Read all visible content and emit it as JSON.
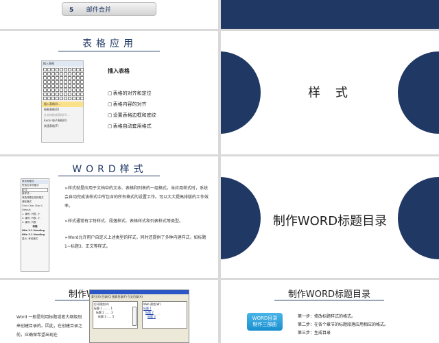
{
  "slide1": {
    "num": "5",
    "label": "邮件合并"
  },
  "slide3": {
    "title": "表格应用",
    "menu": {
      "header": "插入表格",
      "items": [
        "插入表格(I)...",
        "绘制表格(D)",
        "文本转换成表格(V)...",
        "Excel 电子表格(X)",
        "快速表格(T)"
      ]
    },
    "heading": "插入表格",
    "bullets": [
      "表格的对齐和定位",
      "表格内容的对齐",
      "设置表格边框和底纹",
      "表格自动套用格式"
    ]
  },
  "slide4": {
    "title": "样 式"
  },
  "slide5": {
    "title": "WORD样式",
    "panel_lines": [
      "样式和格式",
      "所选文字的格式",
      "正文",
      "新样式...",
      "请选择要应用的格式",
      "清除格式",
      "Char Char Char C",
      "Default",
      "1. 编号, 列表, 小",
      "2. 编号, 列表, 小",
      "3. 编号, 列表",
      "标题",
      "title 2.1 Heading",
      "title 2.1 Heading",
      "显示: 有效格式"
    ],
    "paragraphs": [
      "➢样式就是应用于文档中的文本、表格和列表的一组格式。当应用样式时，系统会自动完成该样式中所包含的所有格式的设置工作。可以大大提高排版的工作效率。",
      "➢样式通常有字符样式、段落样式、表格样式和列表样式等类型。",
      "➢Word允许用户自定义上述类型的样式，同时还提供了多种内建样式，如标题1~标题3、正文等样式。"
    ]
  },
  "slide6": {
    "title": "制作WORD标题目录"
  },
  "slide7": {
    "title": "制作WORD标题目录",
    "text": "Word 一般是利用标题或者大纲级别来创建目录的。因此，在创建目录之前，应确保希望出现在",
    "dialog": {
      "tabs": [
        "索引(X)",
        "目录(C)",
        "图表目录(F)",
        "引文目录(A)"
      ],
      "left_lines": [
        "打印预览(V)",
        "标题 1 ........ 1",
        "标题 2 ...... 3",
        "标题 3 ..... 5"
      ],
      "right_lines": [
        "Web 预览(W)",
        "标题 1",
        "标题 2",
        "标题 3"
      ]
    }
  },
  "slide8": {
    "title": "制作WORD标题目录",
    "pill": [
      "WORD目录",
      "制作三部曲"
    ],
    "steps": [
      "第一步：修改标题样式的格式。",
      "第二步：在各个章节的标题段落应用相应的格式。",
      "第三步：生成目录"
    ]
  }
}
